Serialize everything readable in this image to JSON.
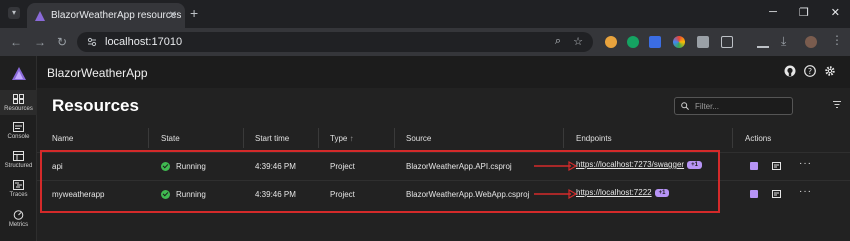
{
  "browser": {
    "tab_title": "BlazorWeatherApp resources",
    "tab_close": "✕",
    "new_tab": "+",
    "url": "localhost:17010",
    "window_controls": [
      "─",
      "❐",
      "✕"
    ]
  },
  "app": {
    "title": "BlazorWeatherApp",
    "nav": [
      {
        "label": "Resources",
        "icon": "resources-icon"
      },
      {
        "label": "Console",
        "icon": "console-icon"
      },
      {
        "label": "Structured",
        "icon": "structured-icon"
      },
      {
        "label": "Traces",
        "icon": "traces-icon"
      },
      {
        "label": "Metrics",
        "icon": "metrics-icon"
      }
    ]
  },
  "page": {
    "heading": "Resources",
    "filter_placeholder": "Filter..."
  },
  "table": {
    "columns": [
      "Name",
      "State",
      "Start time",
      "Type",
      "Source",
      "Endpoints",
      "Actions"
    ],
    "sort_indicator": "↑",
    "rows": [
      {
        "name": "api",
        "state": "Running",
        "start_time": "4:39:46 PM",
        "type": "Project",
        "source": "BlazorWeatherApp.API.csproj",
        "endpoint": "https://localhost:7273/swagger",
        "endpoint_extra": "+1"
      },
      {
        "name": "myweatherapp",
        "state": "Running",
        "start_time": "4:39:46 PM",
        "type": "Project",
        "source": "BlazorWeatherApp.WebApp.csproj",
        "endpoint": "https://localhost:7222",
        "endpoint_extra": "+1"
      }
    ],
    "more_actions": "···"
  },
  "colors": {
    "accent": "#b794f6",
    "running": "#3fb950",
    "annotation": "#d42a2a"
  }
}
